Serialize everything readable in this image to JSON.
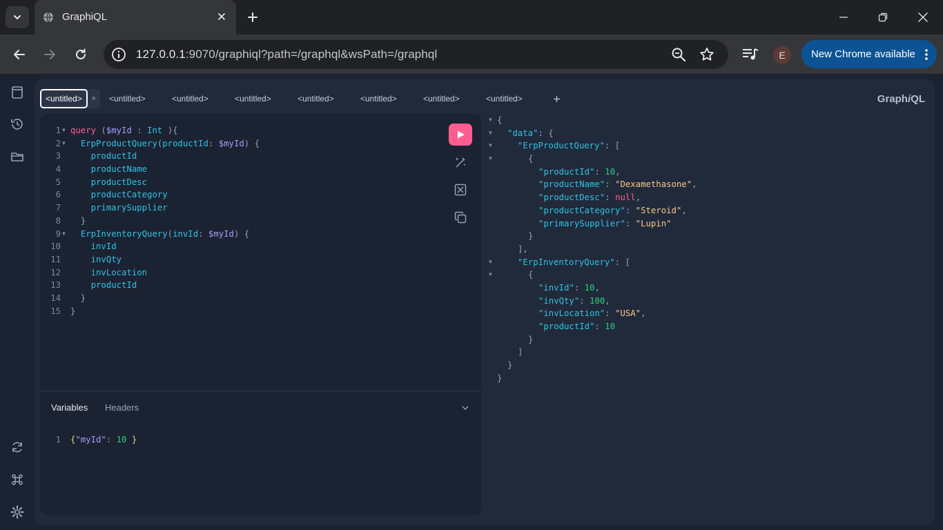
{
  "browser": {
    "tab_title": "GraphiQL",
    "url_host": "127.0.0.1",
    "url_rest": ":9070/graphiql?path=/graphql&wsPath=/graphql",
    "profile_initial": "E",
    "update_label": "New Chrome available"
  },
  "graphiql": {
    "brand_pre": "Graph",
    "brand_i": "i",
    "brand_post": "QL",
    "tabs": [
      "<untitled>",
      "<untitled>",
      "<untitled>",
      "<untitled>",
      "<untitled>",
      "<untitled>",
      "<untitled>",
      "<untitled>"
    ],
    "tab_close": "×",
    "variables_tab": "Variables",
    "headers_tab": "Headers"
  },
  "query_lines": [
    "1",
    "2",
    "3",
    "4",
    "5",
    "6",
    "7",
    "8",
    "9",
    "10",
    "11",
    "12",
    "13",
    "14",
    "15"
  ],
  "query": {
    "l1_kw": "query",
    "l1_open": " (",
    "l1_var": "$myId",
    "l1_colon": " : ",
    "l1_type": "Int",
    "l1_close": " ){",
    "l2_fn": "ErpProductQuery",
    "l2_arg": "productId",
    "l2_var": "$myId",
    "fields1": [
      "productId",
      "productName",
      "productDesc",
      "productCategory",
      "primarySupplier"
    ],
    "l9_fn": "ErpInventoryQuery",
    "l9_arg": "invId",
    "l9_var": "$myId",
    "fields2": [
      "invId",
      "invQty",
      "invLocation",
      "productId"
    ]
  },
  "variables": {
    "line_no": "1",
    "key": "\"myId\"",
    "value": "10"
  },
  "result": {
    "data_key": "\"data\"",
    "q1_key": "\"ErpProductQuery\"",
    "p_id_key": "\"productId\"",
    "p_id_val": "10",
    "p_name_key": "\"productName\"",
    "p_name_val": "\"Dexamethasone\"",
    "p_desc_key": "\"productDesc\"",
    "p_desc_val": "null",
    "p_cat_key": "\"productCategory\"",
    "p_cat_val": "\"Steroid\"",
    "p_sup_key": "\"primarySupplier\"",
    "p_sup_val": "\"Lupin\"",
    "q2_key": "\"ErpInventoryQuery\"",
    "i_id_key": "\"invId\"",
    "i_id_val": "10",
    "i_qty_key": "\"invQty\"",
    "i_qty_val": "100",
    "i_loc_key": "\"invLocation\"",
    "i_loc_val": "\"USA\"",
    "i_pid_key": "\"productId\"",
    "i_pid_val": "10"
  },
  "colors": {
    "accent": "#ff5d8f",
    "keyword": "#ff5d8f",
    "variable": "#a89cf7",
    "field": "#2fc3e3",
    "number": "#2fcf7c",
    "string": "#f7c98a",
    "chrome_update": "#0b5394"
  }
}
